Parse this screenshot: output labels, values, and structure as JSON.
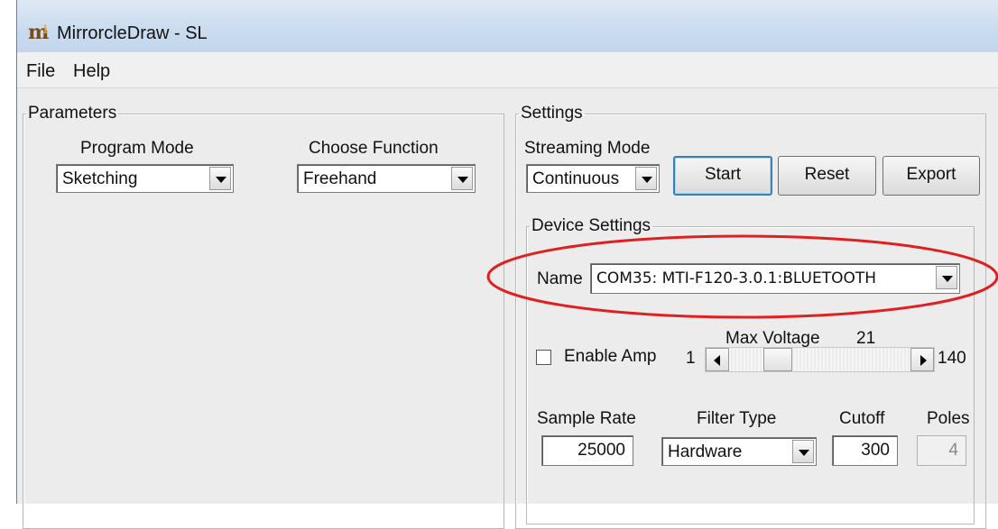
{
  "window": {
    "title": "MirrorcleDraw - SL",
    "icon": "mirrorcle-logo-icon"
  },
  "menu": [
    "File",
    "Help"
  ],
  "parameters": {
    "group_label": "Parameters",
    "program_mode_label": "Program Mode",
    "program_mode_value": "Sketching",
    "choose_function_label": "Choose Function",
    "choose_function_value": "Freehand"
  },
  "settings": {
    "group_label": "Settings",
    "streaming_mode_label": "Streaming Mode",
    "streaming_mode_value": "Continuous",
    "start_label": "Start",
    "reset_label": "Reset",
    "export_label": "Export"
  },
  "device": {
    "group_label": "Device Settings",
    "name_label": "Name",
    "name_value": "COM35: MTI-F120-3.0.1:BLUETOOTH",
    "highlight_color": "#e02020"
  },
  "amp": {
    "enable_label": "Enable Amp",
    "enabled": false,
    "max_voltage_label": "Max Voltage",
    "max_voltage_value": "21",
    "min": "1",
    "max": "140",
    "slider_value": 21
  },
  "signal": {
    "sample_rate_label": "Sample Rate",
    "sample_rate_value": "25000",
    "filter_type_label": "Filter Type",
    "filter_type_value": "Hardware",
    "cutoff_label": "Cutoff",
    "cutoff_value": "300",
    "poles_label": "Poles",
    "poles_value": "4"
  }
}
